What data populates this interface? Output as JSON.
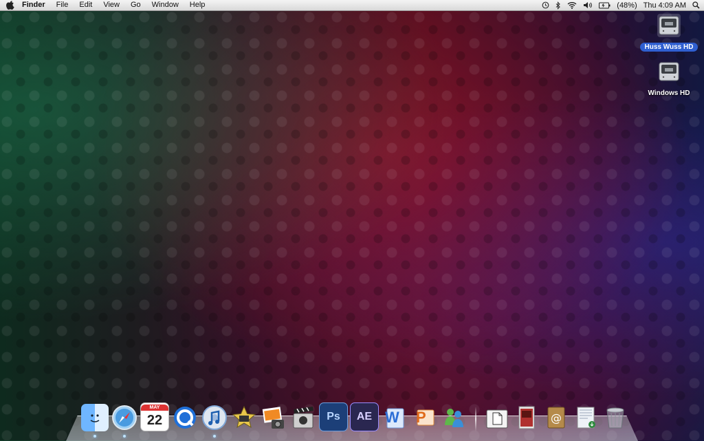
{
  "menubar": {
    "app_name": "Finder",
    "menus": [
      "File",
      "Edit",
      "View",
      "Go",
      "Window",
      "Help"
    ],
    "battery_text": "(48%)",
    "clock": "Thu 4:09 AM"
  },
  "desktop": {
    "disks": [
      {
        "label": "Huss Wuss HD",
        "selected": true
      },
      {
        "label": "Windows HD",
        "selected": false
      }
    ]
  },
  "dock": {
    "apps": [
      {
        "name": "finder-icon",
        "label": ""
      },
      {
        "name": "safari-icon",
        "label": ""
      },
      {
        "name": "ical-icon",
        "month": "MAY",
        "day": "22"
      },
      {
        "name": "quicktime-icon",
        "label": ""
      },
      {
        "name": "itunes-icon",
        "label": ""
      },
      {
        "name": "imovie-icon",
        "label": ""
      },
      {
        "name": "iphoto-icon",
        "label": ""
      },
      {
        "name": "final-cut-icon",
        "label": ""
      },
      {
        "name": "photoshop-icon",
        "label": "Ps"
      },
      {
        "name": "after-effects-icon",
        "label": "AE"
      },
      {
        "name": "word-icon",
        "label": "W"
      },
      {
        "name": "powerpoint-icon",
        "label": "P"
      },
      {
        "name": "messenger-icon",
        "label": ""
      }
    ],
    "docs": [
      {
        "name": "documents-stack-icon"
      },
      {
        "name": "pictures-stack-icon"
      },
      {
        "name": "address-book-icon"
      },
      {
        "name": "downloads-stack-icon"
      },
      {
        "name": "trash-icon"
      }
    ]
  },
  "colors": {
    "selection": "#2f5fd0",
    "menubar_top": "#f4f4f4",
    "menubar_bottom": "#d9d9d9"
  }
}
